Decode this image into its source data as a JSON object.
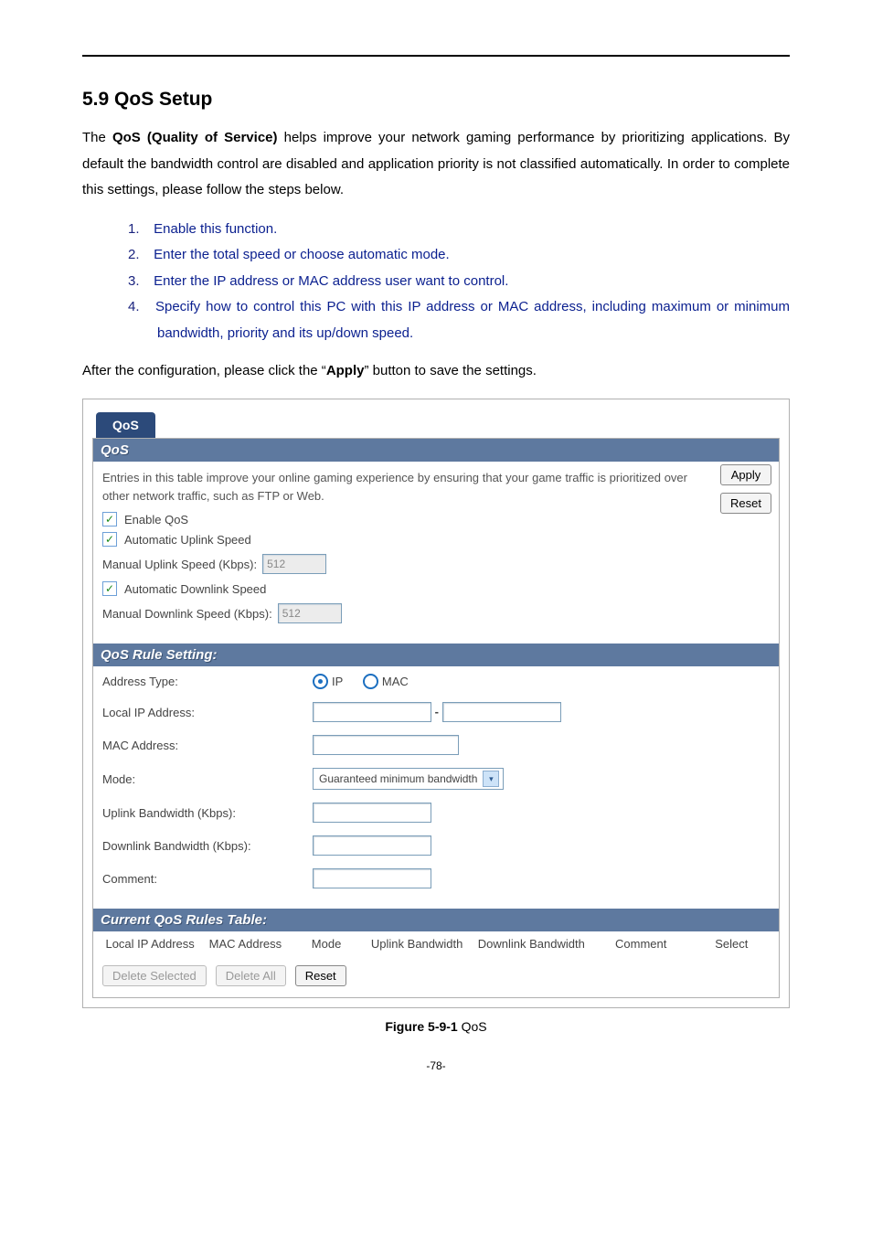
{
  "heading": "5.9  QoS Setup",
  "intro_html": "The <b>QoS (Quality of Service)</b> helps improve your network gaming performance by prioritizing applications. By default the bandwidth control are disabled and application priority is not classified automatically. In order to complete this settings, please follow the steps below.",
  "steps": [
    "Enable this function.",
    "Enter the total speed or choose automatic mode.",
    "Enter the IP address or MAC address user want to control.",
    "Specify how to control this PC with this IP address or MAC address, including maximum or minimum bandwidth, priority and its up/down speed."
  ],
  "after_html": "After the configuration, please click the “<b>Apply</b>” button to save the settings.",
  "caption_html": "<b>Figure 5-9-1</b> QoS",
  "page_number": "-78-",
  "panel": {
    "tab": "QoS",
    "apply_btn": "Apply",
    "reset_btn": "Reset",
    "section1_title": "QoS",
    "intro": "Entries in this table improve your online gaming experience by ensuring that your game traffic is prioritized over other network traffic, such as FTP or Web.",
    "chk_enable": "Enable QoS",
    "chk_auto_up": "Automatic Uplink Speed",
    "manual_up_label": "Manual Uplink Speed (Kbps):",
    "manual_up_value": "512",
    "chk_auto_down": "Automatic Downlink Speed",
    "manual_down_label": "Manual Downlink Speed (Kbps):",
    "manual_down_value": "512",
    "section2_title": "QoS Rule Setting:",
    "addr_type_label": "Address Type:",
    "addr_type_ip": "IP",
    "addr_type_mac": "MAC",
    "local_ip_label": "Local IP Address:",
    "ip_sep": "-",
    "mac_addr_label": "MAC Address:",
    "mode_label": "Mode:",
    "mode_value": "Guaranteed minimum bandwidth",
    "up_bw_label": "Uplink Bandwidth (Kbps):",
    "down_bw_label": "Downlink Bandwidth (Kbps):",
    "comment_label": "Comment:",
    "section3_title": "Current QoS Rules Table:",
    "th_local_ip": "Local IP Address",
    "th_mac": "MAC Address",
    "th_mode": "Mode",
    "th_up": "Uplink Bandwidth",
    "th_down": "Downlink Bandwidth",
    "th_comment": "Comment",
    "th_select": "Select",
    "btn_delete_selected": "Delete Selected",
    "btn_delete_all": "Delete All",
    "btn_reset2": "Reset"
  }
}
